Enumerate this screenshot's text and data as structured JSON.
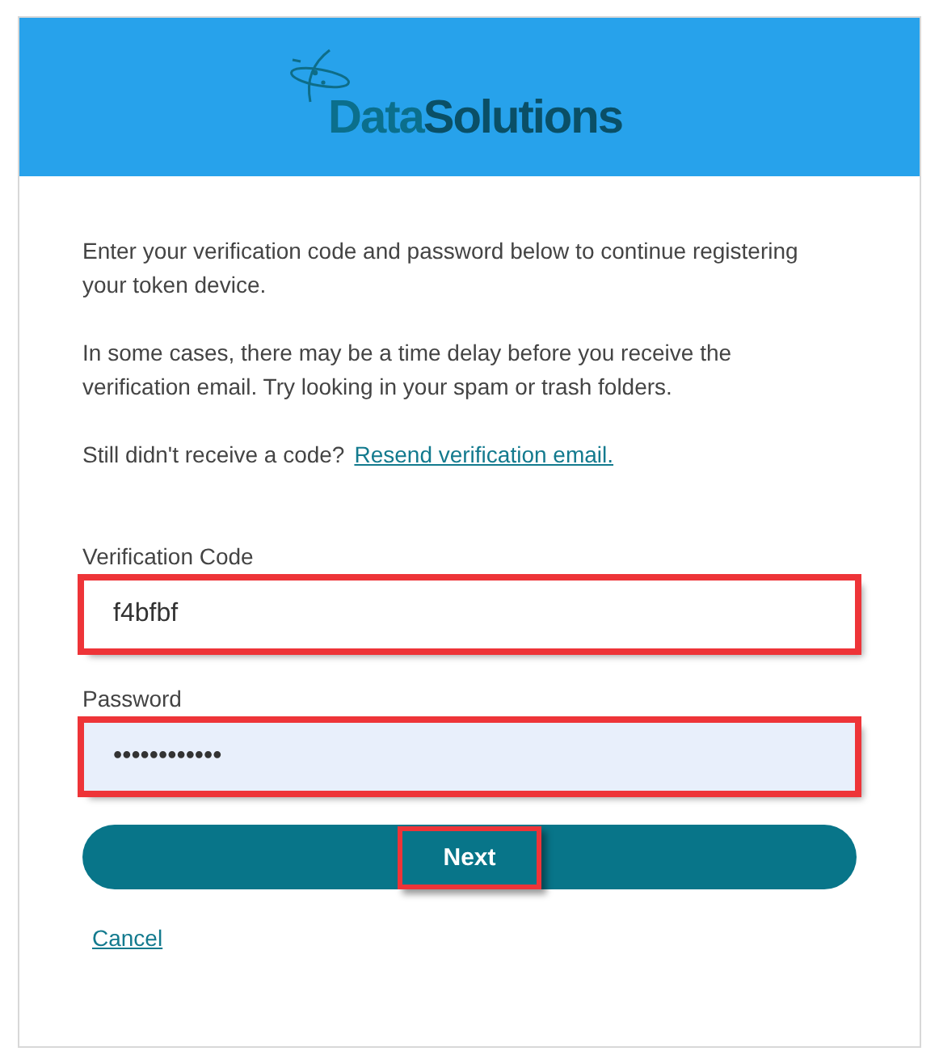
{
  "logo": {
    "parts": [
      "Data",
      "Solutions"
    ]
  },
  "paragraphs": [
    "Enter your verification code and password below to continue registering your token device.",
    "In some cases, there may be a time delay before you receive the verification email. Try looking in your spam or trash folders."
  ],
  "resend": {
    "text": "Still didn't receive a code?",
    "link": "Resend verification email."
  },
  "fields": [
    {
      "label": "Verification Code",
      "value": "f4bfbf",
      "kind": "text",
      "highlighted": true
    },
    {
      "label": "Password",
      "value": "••••••••••••",
      "kind": "password",
      "highlighted": true
    }
  ],
  "next_button": {
    "label": "Next",
    "highlighted": true
  },
  "cancel_link": "Cancel"
}
